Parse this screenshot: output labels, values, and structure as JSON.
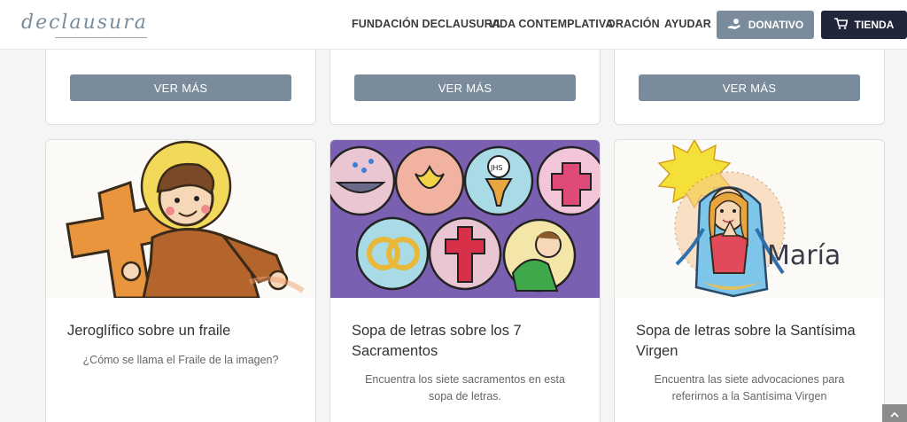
{
  "header": {
    "logo_text": "declausura",
    "nav": [
      "FUNDACIÓN DECLAUSURA",
      "VIDA CONTEMPLATIVA",
      "ORACIÓN",
      "AYUDAR"
    ],
    "donativo_label": "DONATIVO",
    "tienda_label": "TIENDA"
  },
  "top_cards": {
    "button_label": "VER MÁS"
  },
  "cards": [
    {
      "title": "Jeroglífico sobre un fraile",
      "description": "¿Cómo se llama el Fraile de la imagen?"
    },
    {
      "title": "Sopa de letras sobre los 7 Sacramentos",
      "description": "Encuentra los siete sacramentos en esta sopa de letras."
    },
    {
      "title": "Sopa de letras sobre la Santísima Virgen",
      "description": "Encuentra las siete advocaciones para referirnos a la Santísima Virgen",
      "image_text": "María"
    }
  ],
  "colors": {
    "button_gray": "#7a8c9b",
    "tienda_dark": "#22263a",
    "purple_bg": "#7b5fb0"
  },
  "icons": {
    "donativo": "hand-donation-icon",
    "tienda": "cart-icon",
    "scroll": "chevron-up-icon"
  }
}
